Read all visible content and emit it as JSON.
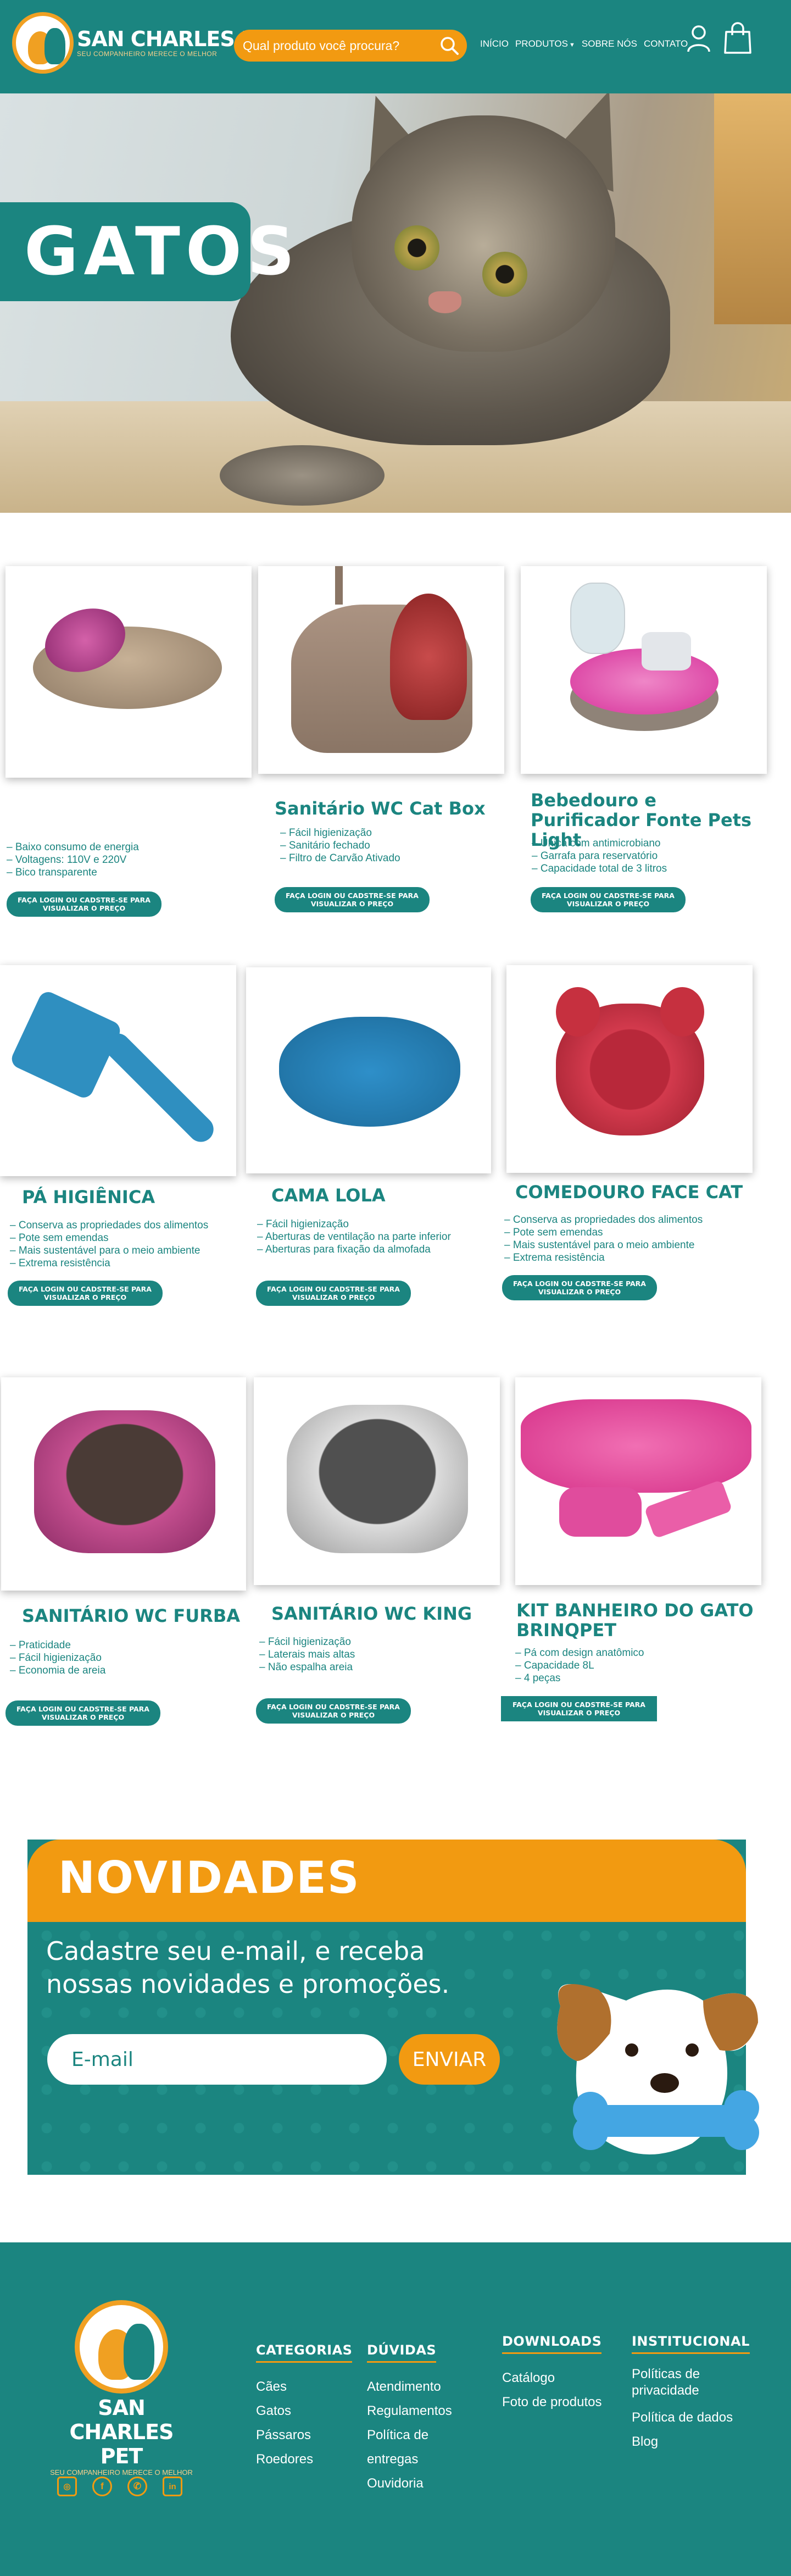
{
  "colors": {
    "brand": "#1b8580",
    "accent": "#f29a11",
    "white": "#ffffff"
  },
  "header": {
    "logo_name": "SAN CHARLES PET",
    "logo_tagline": "SEU COMPANHEIRO MERECE O MELHOR",
    "search_placeholder": "Qual produto você procura?",
    "search_icon": "search-icon",
    "nav": [
      "INÍCIO",
      "PRODUTOS",
      "SOBRE NÓS",
      "CONTATO"
    ],
    "user_icon": "user-icon",
    "cart_icon": "bag-icon"
  },
  "hero": {
    "title": "GATOS"
  },
  "products": [
    {
      "name": "",
      "features": [
        "Baixo consumo de energia",
        "Voltagens: 110V e 220V",
        "Bico transparente"
      ],
      "cta": "FAÇA LOGIN OU CADSTRE-SE PARA VISUALIZAR O PREÇO"
    },
    {
      "name": "Sanitário WC Cat Box",
      "features": [
        "Fácil higienização",
        "Sanitário fechado",
        "Filtro de Carvão Ativado"
      ],
      "cta": "FAÇA LOGIN OU CADSTRE-SE PARA VISUALIZAR O PREÇO"
    },
    {
      "name": "Bebedouro e Purificador Fonte Pets Light",
      "features": [
        "Única com antimicrobiano",
        "Garrafa para reservatório",
        "Capacidade total de 3 litros"
      ],
      "cta": "FAÇA LOGIN OU CADSTRE-SE PARA VISUALIZAR O PREÇO"
    },
    {
      "name": "PÁ HIGIÊNICA",
      "features": [
        "Conserva as propriedades dos alimentos",
        "Pote sem emendas",
        "Mais sustentável para o meio ambiente",
        "Extrema resistência"
      ],
      "cta": "FAÇA LOGIN OU CADSTRE-SE PARA VISUALIZAR O PREÇO"
    },
    {
      "name": "CAMA  LOLA",
      "features": [
        "Fácil higienização",
        "Aberturas de ventilação na parte inferior",
        "Aberturas para fixação da almofada"
      ],
      "cta": "FAÇA LOGIN OU CADSTRE-SE PARA VISUALIZAR O PREÇO"
    },
    {
      "name": "COMEDOURO FACE CAT",
      "features": [
        "Conserva as propriedades dos alimentos",
        "Pote sem emendas",
        "Mais sustentável para o meio ambiente",
        "Extrema resistência"
      ],
      "cta": "FAÇA LOGIN OU CADSTRE-SE PARA VISUALIZAR O PREÇO"
    },
    {
      "name": "SANITÁRIO WC FURBA",
      "features": [
        "Praticidade",
        "Fácil higienização",
        "Economia de areia"
      ],
      "cta": "FAÇA LOGIN OU CADSTRE-SE PARA VISUALIZAR O PREÇO"
    },
    {
      "name": "SANITÁRIO WC KING",
      "features": [
        "Fácil higienização",
        "Laterais mais altas",
        "Não espalha areia"
      ],
      "cta": "FAÇA LOGIN OU CADSTRE-SE PARA VISUALIZAR O PREÇO"
    },
    {
      "name": "KIT BANHEIRO DO GATO BRINQPET",
      "features": [
        "Pá com design anatômico",
        "Capacidade 8L",
        "4 peças"
      ],
      "cta": "FAÇA LOGIN OU CADSTRE-SE PARA VISUALIZAR O PREÇO"
    }
  ],
  "newsletter": {
    "title": "NOVIDADES",
    "subtitle": "Cadastre seu e-mail, e receba nossas novidades e promoções.",
    "email_placeholder": "E-mail",
    "button": "ENVIAR"
  },
  "footer": {
    "logo_name": "SAN CHARLES PET",
    "logo_tagline": "SEU COMPANHEIRO MERECE O MELHOR",
    "socials": [
      "instagram-icon",
      "facebook-icon",
      "whatsapp-icon",
      "linkedin-icon"
    ],
    "columns": [
      {
        "title": "CATEGORIAS",
        "links": [
          "Cães",
          "Gatos",
          "Pássaros",
          "Roedores"
        ]
      },
      {
        "title": "DÚVIDAS",
        "links": [
          "Atendimento",
          "Regulamentos",
          "Política de entregas",
          "Ouvidoria"
        ]
      },
      {
        "title": "DOWNLOADS",
        "links": [
          "Catálogo",
          "Foto de produtos"
        ]
      },
      {
        "title": "INSTITUCIONAL",
        "links": [
          "Políticas de privacidade",
          "Política de dados",
          "Blog"
        ]
      }
    ]
  }
}
